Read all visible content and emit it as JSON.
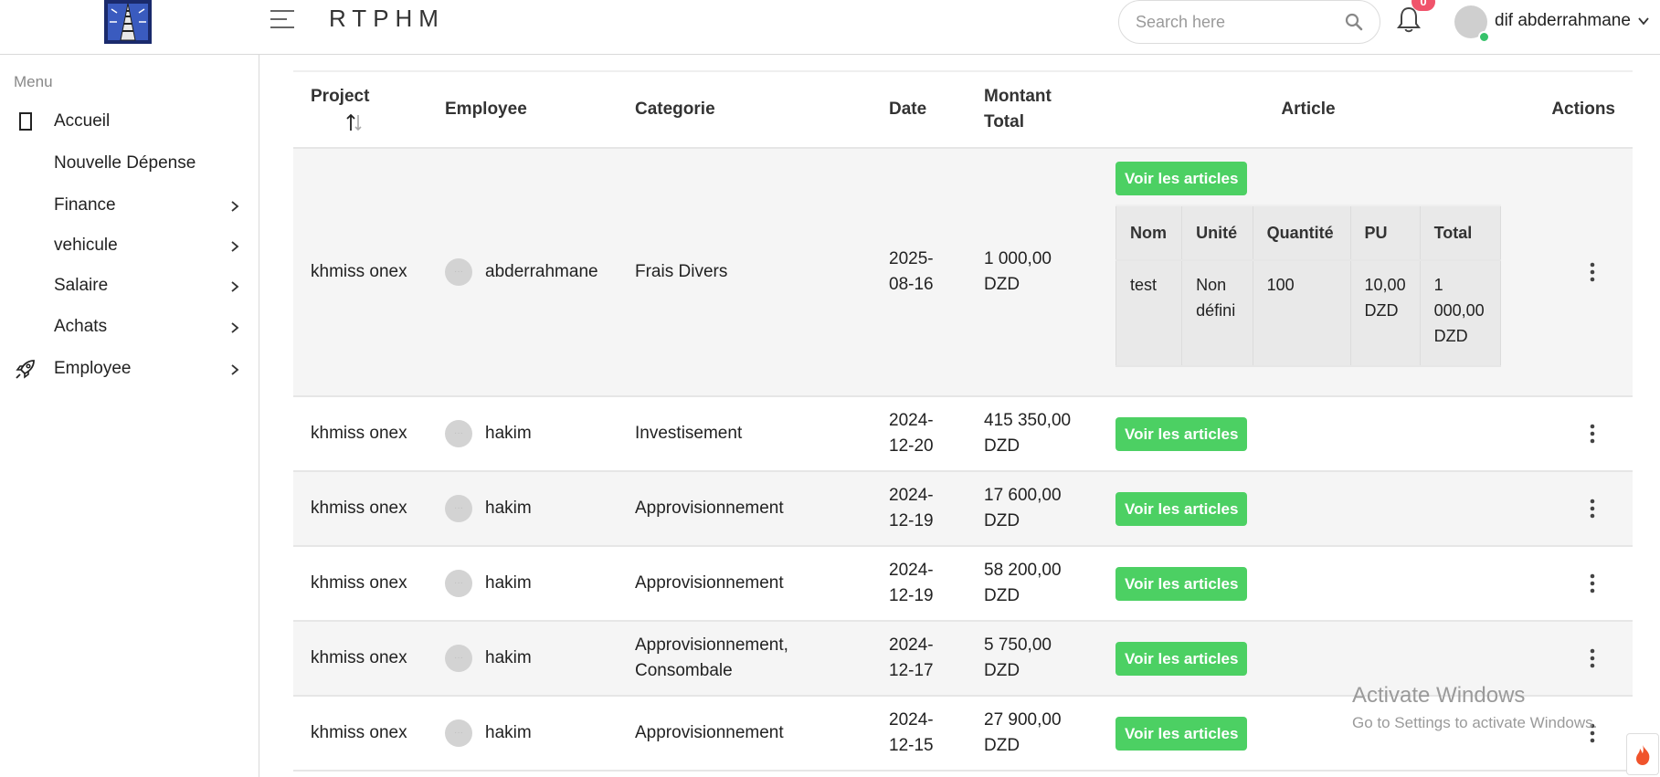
{
  "header": {
    "brand": "RTPHM",
    "search_placeholder": "Search here",
    "notifications_count": "0",
    "user_name": "dif abderrahmane"
  },
  "sidebar": {
    "menu_title": "Menu",
    "items": [
      {
        "label": "Accueil"
      },
      {
        "label": "Nouvelle Dépense"
      },
      {
        "label": "Finance"
      },
      {
        "label": "vehicule"
      },
      {
        "label": "Salaire"
      },
      {
        "label": "Achats"
      },
      {
        "label": "Employee"
      }
    ]
  },
  "table": {
    "headers": {
      "project": "Project",
      "employee": "Employee",
      "categorie": "Categorie",
      "date": "Date",
      "montant": "Montant Total",
      "article": "Article",
      "actions": "Actions"
    },
    "button_label": "Voir les articles",
    "rows": [
      {
        "project": "khmiss onex",
        "employee": "abderrahmane",
        "categorie": "Frais Divers",
        "date": "2025-08-16",
        "montant": "1 000,00 DZD"
      },
      {
        "project": "khmiss onex",
        "employee": "hakim",
        "categorie": "Investisement",
        "date": "2024-12-20",
        "montant": "415 350,00 DZD"
      },
      {
        "project": "khmiss onex",
        "employee": "hakim",
        "categorie": "Approvisionnement",
        "date": "2024-12-19",
        "montant": "17 600,00 DZD"
      },
      {
        "project": "khmiss onex",
        "employee": "hakim",
        "categorie": "Approvisionnement",
        "date": "2024-12-19",
        "montant": "58 200,00 DZD"
      },
      {
        "project": "khmiss onex",
        "employee": "hakim",
        "categorie": "Approvisionnement, Consombale",
        "date": "2024-12-17",
        "montant": "5 750,00 DZD"
      },
      {
        "project": "khmiss onex",
        "employee": "hakim",
        "categorie": "Approvisionnement",
        "date": "2024-12-15",
        "montant": "27 900,00 DZD"
      }
    ],
    "articles": {
      "headers": {
        "nom": "Nom",
        "unite": "Unité",
        "quantite": "Quantité",
        "pu": "PU",
        "total": "Total"
      },
      "rows": [
        {
          "nom": "test",
          "unite": "Non défini",
          "quantite": "100",
          "pu": "10,00 DZD",
          "total": "1 000,00 DZD"
        }
      ]
    }
  },
  "watermark": {
    "line1": "Activate Windows",
    "line2": "Go to Settings to activate Windows."
  },
  "colors": {
    "accent_green": "#4cd063",
    "badge_red": "#f0536b",
    "row_striped": "#f5f5f5"
  }
}
